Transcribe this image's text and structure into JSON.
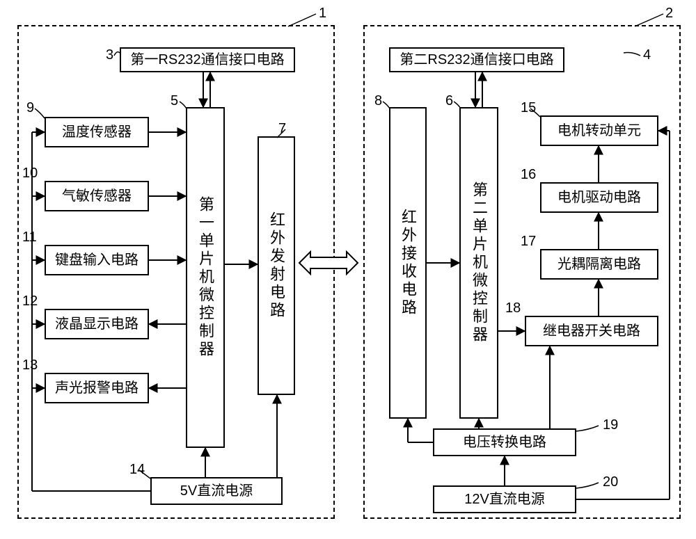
{
  "left": {
    "number": "1",
    "rs232": {
      "label": "第一RS232通信接口电路",
      "num": "3"
    },
    "mcu": {
      "label": "第一单片机微控制器",
      "num": "5"
    },
    "irtx": {
      "label": "红外发射电路",
      "num": "7"
    },
    "items": [
      {
        "label": "温度传感器",
        "num": "9"
      },
      {
        "label": "气敏传感器",
        "num": "10"
      },
      {
        "label": "键盘输入电路",
        "num": "11"
      },
      {
        "label": "液晶显示电路",
        "num": "12"
      },
      {
        "label": "声光报警电路",
        "num": "13"
      }
    ],
    "power": {
      "label": "5V直流电源",
      "num": "14"
    }
  },
  "right": {
    "number": "2",
    "rs232": {
      "label": "第二RS232通信接口电路",
      "num": "4"
    },
    "mcu": {
      "label": "第二单片机微控制器",
      "num": "6"
    },
    "irrx": {
      "label": "红外接收电路",
      "num": "8"
    },
    "items": [
      {
        "label": "电机转动单元",
        "num": "15"
      },
      {
        "label": "电机驱动电路",
        "num": "16"
      },
      {
        "label": "光耦隔离电路",
        "num": "17"
      },
      {
        "label": "继电器开关电路",
        "num": "18"
      }
    ],
    "vconv": {
      "label": "电压转换电路",
      "num": "19"
    },
    "power": {
      "label": "12V直流电源",
      "num": "20"
    }
  }
}
